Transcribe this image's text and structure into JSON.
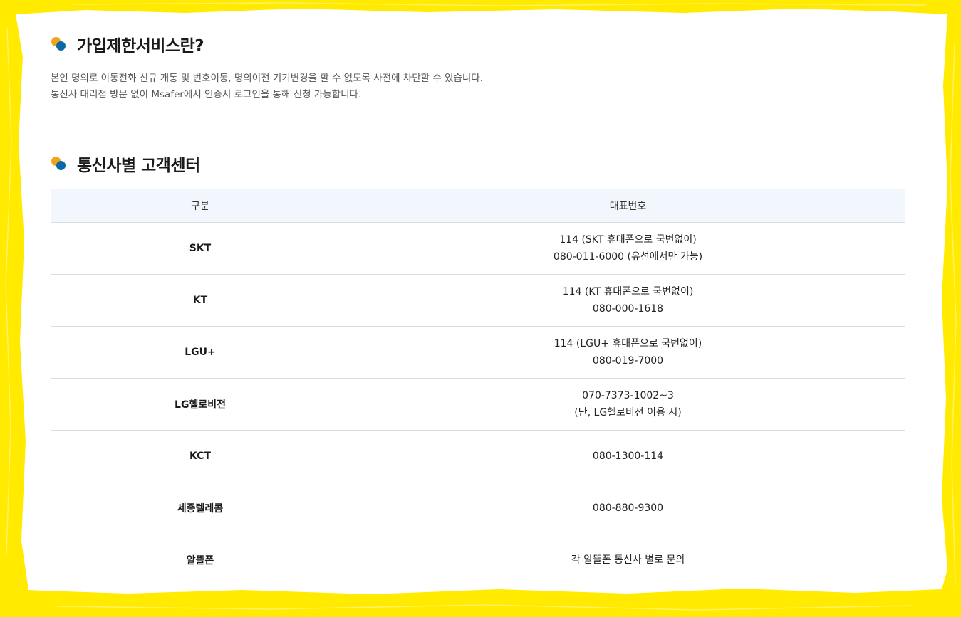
{
  "sections": {
    "intro": {
      "title": "가입제한서비스란?",
      "lines": [
        "본인 명의로 이동전화 신규 개통 및 번호이동, 명의이전 기기변경을 할 수 없도록 사전에 차단할 수 있습니다.",
        "통신사 대리점 방문 없이 Msafer에서 인증서 로그인을 통해 신청 가능합니다."
      ]
    },
    "centers": {
      "title": "통신사별 고객센터"
    }
  },
  "table": {
    "headers": [
      "구분",
      "대표번호"
    ],
    "rows": [
      {
        "name": "SKT",
        "numbers": [
          "114 (SKT 휴대폰으로 국번없이)",
          "080-011-6000 (유선에서만 가능)"
        ]
      },
      {
        "name": "KT",
        "numbers": [
          "114 (KT 휴대폰으로 국번없이)",
          "080-000-1618"
        ]
      },
      {
        "name": "LGU+",
        "numbers": [
          "114 (LGU+ 휴대폰으로 국번없이)",
          "080-019-7000"
        ]
      },
      {
        "name": "LG헬로비전",
        "numbers": [
          "070-7373-1002~3",
          "(단, LG헬로비전 이용 시)"
        ]
      },
      {
        "name": "KCT",
        "numbers": [
          "080-1300-114"
        ]
      },
      {
        "name": "세종텔레콤",
        "numbers": [
          "080-880-9300"
        ]
      },
      {
        "name": "알뜰폰",
        "numbers": [
          "각 알뜰폰 통신사 별로 문의"
        ]
      }
    ]
  },
  "colors": {
    "frame": "#ffea00",
    "dot_orange": "#f0a41c",
    "dot_blue": "#0a6aa8",
    "header_bg": "#f2f7fd"
  }
}
